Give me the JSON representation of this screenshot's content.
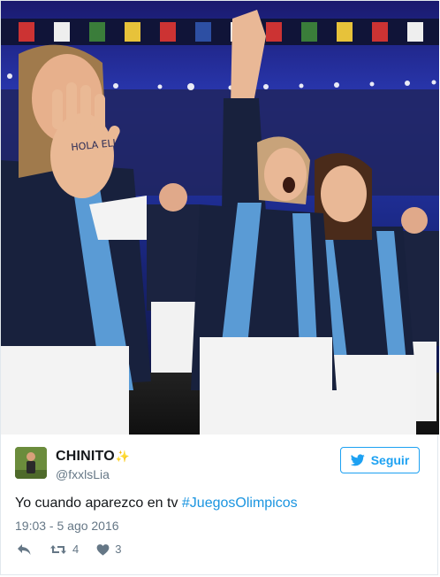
{
  "tweet": {
    "display_name": "CHINITO",
    "name_emoji": "✨",
    "handle": "@fxxlsLia",
    "text_prefix": "Yo cuando aparezco en tv ",
    "hashtag": "#JuegosOlimpicos",
    "timestamp": "19:03 - 5 ago 2016"
  },
  "follow_button": {
    "label": "Seguir",
    "icon": "twitter-bird-icon"
  },
  "actions": {
    "reply_icon": "reply-icon",
    "retweet_icon": "retweet-icon",
    "retweet_count": "4",
    "like_icon": "heart-icon",
    "like_count": "3"
  },
  "media": {
    "description_visible_text": "HOLA ELI",
    "palm_text": "HOLA ELI"
  },
  "colors": {
    "accent": "#1da1f2",
    "hashtag": "#1b95e0",
    "muted": "#657786",
    "text": "#14171a",
    "border": "#e1e8ed"
  }
}
